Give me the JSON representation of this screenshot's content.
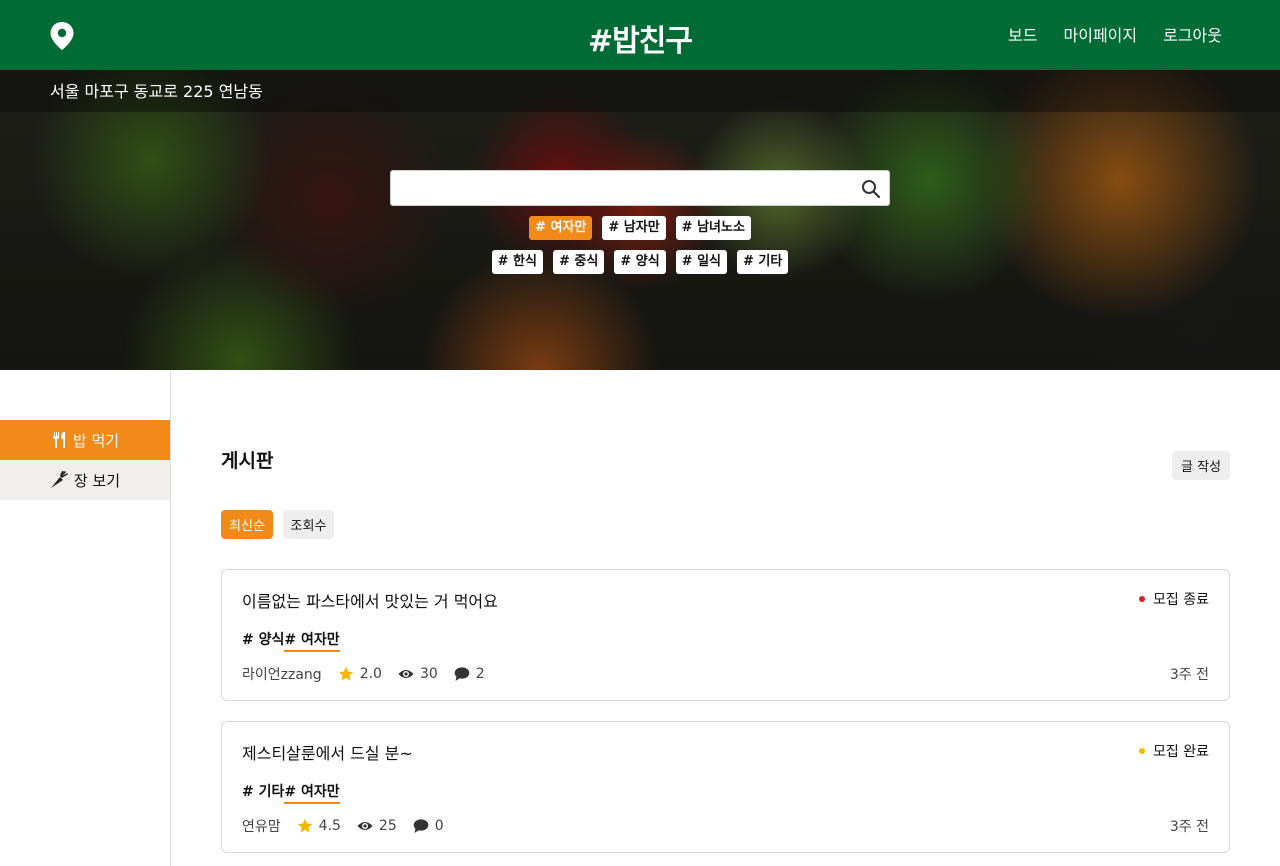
{
  "header": {
    "logo": "#밥친구",
    "nav": [
      "보드",
      "마이페이지",
      "로그아웃"
    ]
  },
  "hero": {
    "address": "서울 마포구 동교로 225 연남동",
    "search": {
      "value": "",
      "placeholder": ""
    },
    "gender_tags": [
      {
        "label": "# 여자만",
        "selected": true
      },
      {
        "label": "# 남자만",
        "selected": false
      },
      {
        "label": "# 남녀노소",
        "selected": false
      }
    ],
    "food_tags": [
      {
        "label": "# 한식"
      },
      {
        "label": "# 중식"
      },
      {
        "label": "# 양식"
      },
      {
        "label": "# 일식"
      },
      {
        "label": "# 기타"
      }
    ]
  },
  "sidebar": {
    "items": [
      {
        "label": "밥 먹기",
        "icon": "utensils-icon",
        "active": true
      },
      {
        "label": "장 보기",
        "icon": "carrot-icon",
        "active": false
      }
    ]
  },
  "board": {
    "title": "게시판",
    "write_label": "글 작성",
    "sort": {
      "latest": "최신순",
      "views": "조회수",
      "selected": "최신순"
    },
    "posts": [
      {
        "title": "이름없는 파스타에서 맛있는 거 먹어요",
        "status": "모집 종료",
        "status_color": "#e02020",
        "tag1": "# 양식",
        "tag2": "# 여자만",
        "author": "라이언zzang",
        "rating": "2.0",
        "views": "30",
        "comments": "2",
        "time": "3주 전"
      },
      {
        "title": "제스티살룬에서 드실 분~",
        "status": "모집 완료",
        "status_color": "#f5b800",
        "tag1": "# 기타",
        "tag2": "# 여자만",
        "author": "연유맘",
        "rating": "4.5",
        "views": "25",
        "comments": "0",
        "time": "3주 전"
      }
    ]
  },
  "colors": {
    "brand_green": "#006b34",
    "accent_orange": "#f28a1a",
    "star": "#f5b800"
  }
}
